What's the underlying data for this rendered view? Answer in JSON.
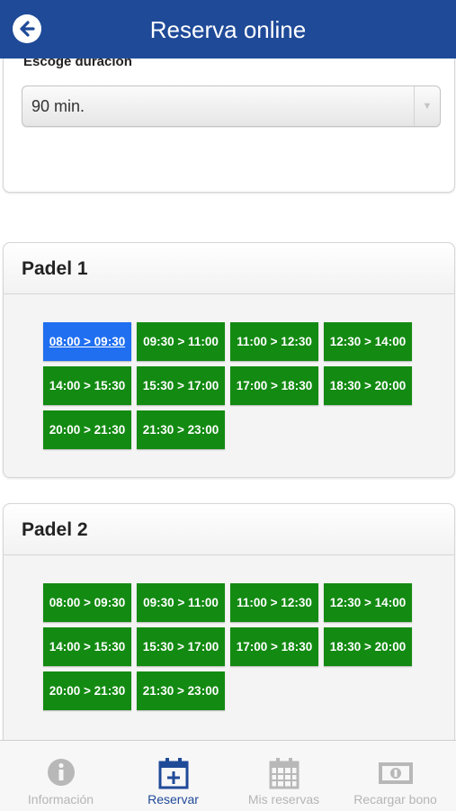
{
  "header": {
    "title": "Reserva online",
    "back_icon": "back-arrow-icon"
  },
  "duration": {
    "label": "Escoge duración",
    "selected": "90 min."
  },
  "courts": [
    {
      "name": "Padel 1",
      "slots": [
        "08:00 > 09:30",
        "09:30 > 11:00",
        "11:00 > 12:30",
        "12:30 > 14:00",
        "14:00 > 15:30",
        "15:30 > 17:00",
        "17:00 > 18:30",
        "18:30 > 20:00",
        "20:00 > 21:30",
        "21:30 > 23:00"
      ],
      "selected_slot": 0
    },
    {
      "name": "Padel 2",
      "slots": [
        "08:00 > 09:30",
        "09:30 > 11:00",
        "11:00 > 12:30",
        "12:30 > 14:00",
        "14:00 > 15:30",
        "15:30 > 17:00",
        "17:00 > 18:30",
        "18:30 > 20:00",
        "20:00 > 21:30",
        "21:30 > 23:00"
      ]
    }
  ],
  "tabs": [
    {
      "label": "Información",
      "icon": "info-icon"
    },
    {
      "label": "Reservar",
      "icon": "calendar-add-icon",
      "active": true
    },
    {
      "label": "Mis reservas",
      "icon": "calendar-grid-icon"
    },
    {
      "label": "Recargar bono",
      "icon": "banknote-icon"
    }
  ],
  "colors": {
    "header": "#1f4a98",
    "slot": "#138a12",
    "slot_selected": "#1f6ff0",
    "tab_active": "#1f4a98",
    "tab_inactive": "#b5b5b5"
  }
}
